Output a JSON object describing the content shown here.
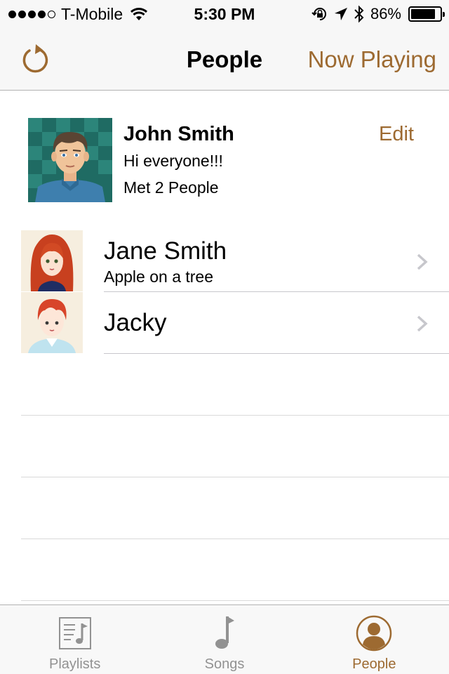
{
  "status_bar": {
    "carrier": "T-Mobile",
    "time": "5:30 PM",
    "battery_percent": "86%",
    "battery_level": 0.86,
    "signal_bars": 4,
    "signal_total": 5
  },
  "nav": {
    "title": "People",
    "right_button": "Now Playing",
    "left_icon": "refresh-icon"
  },
  "profile": {
    "name": "John Smith",
    "status": "Hi everyone!!!",
    "met": "Met 2 People",
    "edit_label": "Edit"
  },
  "people": [
    {
      "name": "Jane Smith",
      "subtitle": "Apple on a tree"
    },
    {
      "name": "Jacky",
      "subtitle": ""
    }
  ],
  "tabs": [
    {
      "label": "Playlists",
      "icon": "playlist-icon",
      "active": false
    },
    {
      "label": "Songs",
      "icon": "music-note-icon",
      "active": false
    },
    {
      "label": "People",
      "icon": "person-icon",
      "active": true
    }
  ],
  "colors": {
    "accent": "#9d6a31",
    "inactive": "#929292",
    "bar_bg": "#f7f7f7"
  }
}
